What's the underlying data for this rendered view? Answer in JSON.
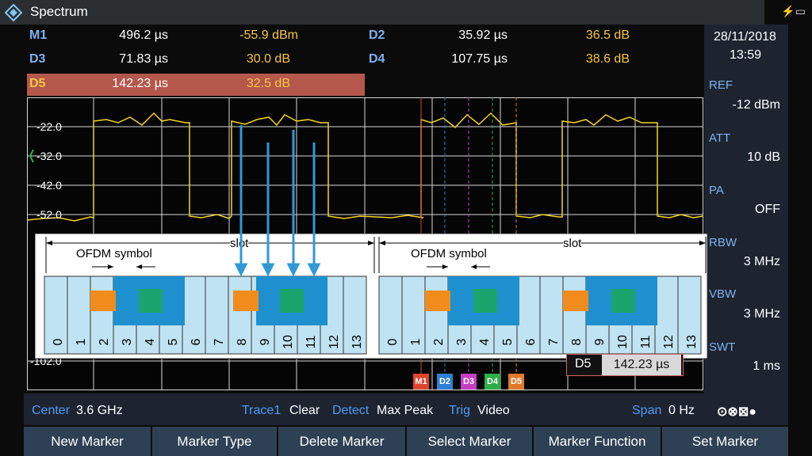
{
  "app": {
    "title": "Spectrum",
    "logo_icon": "rs-diamond-icon",
    "battery_icon": "battery-charging-icon"
  },
  "markers": [
    {
      "name": "M1",
      "time": "496.2 µs",
      "value": "-55.9 dBm"
    },
    {
      "name": "D2",
      "time": "35.92 µs",
      "value": "36.5 dB"
    },
    {
      "name": "D3",
      "time": "71.83 µs",
      "value": "30.0 dB"
    },
    {
      "name": "D4",
      "time": "107.75 µs",
      "value": "38.6 dB"
    },
    {
      "name": "D5",
      "time": "142.23 µs",
      "value": "32.5 dB"
    }
  ],
  "datetime": {
    "date": "28/11/2018",
    "time": "13:59"
  },
  "side_panel": {
    "ref_label": "REF",
    "ref_value": "-12 dBm",
    "att_label": "ATT",
    "att_value": "10 dB",
    "pa_label": "PA",
    "pa_value": "OFF",
    "rbw_label": "RBW",
    "rbw_value": "3 MHz",
    "vbw_label": "VBW",
    "vbw_value": "3 MHz",
    "swt_label": "SWT",
    "swt_value": "1 ms"
  },
  "plot": {
    "y_labels": [
      "-22.0",
      "-32.0",
      "-42.0",
      "-52.0",
      "-102.0"
    ],
    "marker_flags": [
      "M1",
      "D2",
      "D3",
      "D4",
      "D5"
    ],
    "marker_colors": [
      "#e0442c",
      "#2f7fd6",
      "#c43fc4",
      "#2fae4a",
      "#e07a2c"
    ],
    "active_delta": {
      "name": "D5",
      "value": "142.23 µs"
    }
  },
  "diagram": {
    "slot_label": "slot",
    "ofdm_label": "OFDM symbol",
    "symbol_numbers": [
      "0",
      "1",
      "2",
      "3",
      "4",
      "5",
      "6",
      "7",
      "8",
      "9",
      "10",
      "11",
      "12",
      "13"
    ]
  },
  "status": {
    "center_label": "Center",
    "center_value": "3.6 GHz",
    "trace_label": "Trace1",
    "trace_value": "Clear",
    "detect_label": "Detect",
    "detect_value": "Max Peak",
    "trig_label": "Trig",
    "trig_value": "Video",
    "span_label": "Span",
    "span_value": "0 Hz",
    "connector_icon": "connector-status-icon"
  },
  "softkeys": [
    "New Marker",
    "Marker Type",
    "Delete Marker",
    "Select Marker",
    "Marker Function",
    "Set Marker"
  ],
  "colors": {
    "trace": "#f5d320",
    "accent": "#4f9cf5",
    "arrow": "#2f9ad6"
  }
}
